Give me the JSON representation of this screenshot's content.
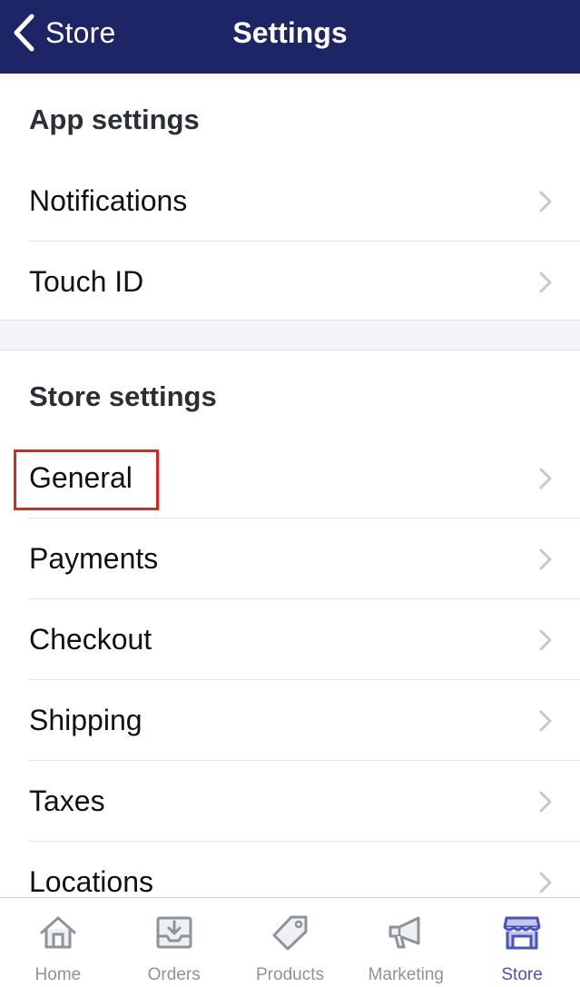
{
  "navbar": {
    "back_label": "Store",
    "title": "Settings",
    "background_color": "#1d2566"
  },
  "app_settings": {
    "header": "App settings",
    "items": [
      {
        "label": "Notifications",
        "icon": "chevron-right-icon"
      },
      {
        "label": "Touch ID",
        "icon": "chevron-right-icon"
      }
    ]
  },
  "store_settings": {
    "header": "Store settings",
    "items": [
      {
        "label": "General",
        "icon": "chevron-right-icon",
        "highlighted": true
      },
      {
        "label": "Payments",
        "icon": "chevron-right-icon"
      },
      {
        "label": "Checkout",
        "icon": "chevron-right-icon"
      },
      {
        "label": "Shipping",
        "icon": "chevron-right-icon"
      },
      {
        "label": "Taxes",
        "icon": "chevron-right-icon"
      },
      {
        "label": "Locations",
        "icon": "chevron-right-icon"
      }
    ]
  },
  "tabbar": {
    "tabs": [
      {
        "label": "Home",
        "icon": "home-icon",
        "active": false
      },
      {
        "label": "Orders",
        "icon": "orders-inbox-icon",
        "active": false
      },
      {
        "label": "Products",
        "icon": "tag-icon",
        "active": false
      },
      {
        "label": "Marketing",
        "icon": "megaphone-icon",
        "active": false
      },
      {
        "label": "Store",
        "icon": "store-icon",
        "active": true
      }
    ],
    "active_color": "#4953b8",
    "inactive_color": "#8e939b"
  },
  "highlight_color": "#e02424"
}
